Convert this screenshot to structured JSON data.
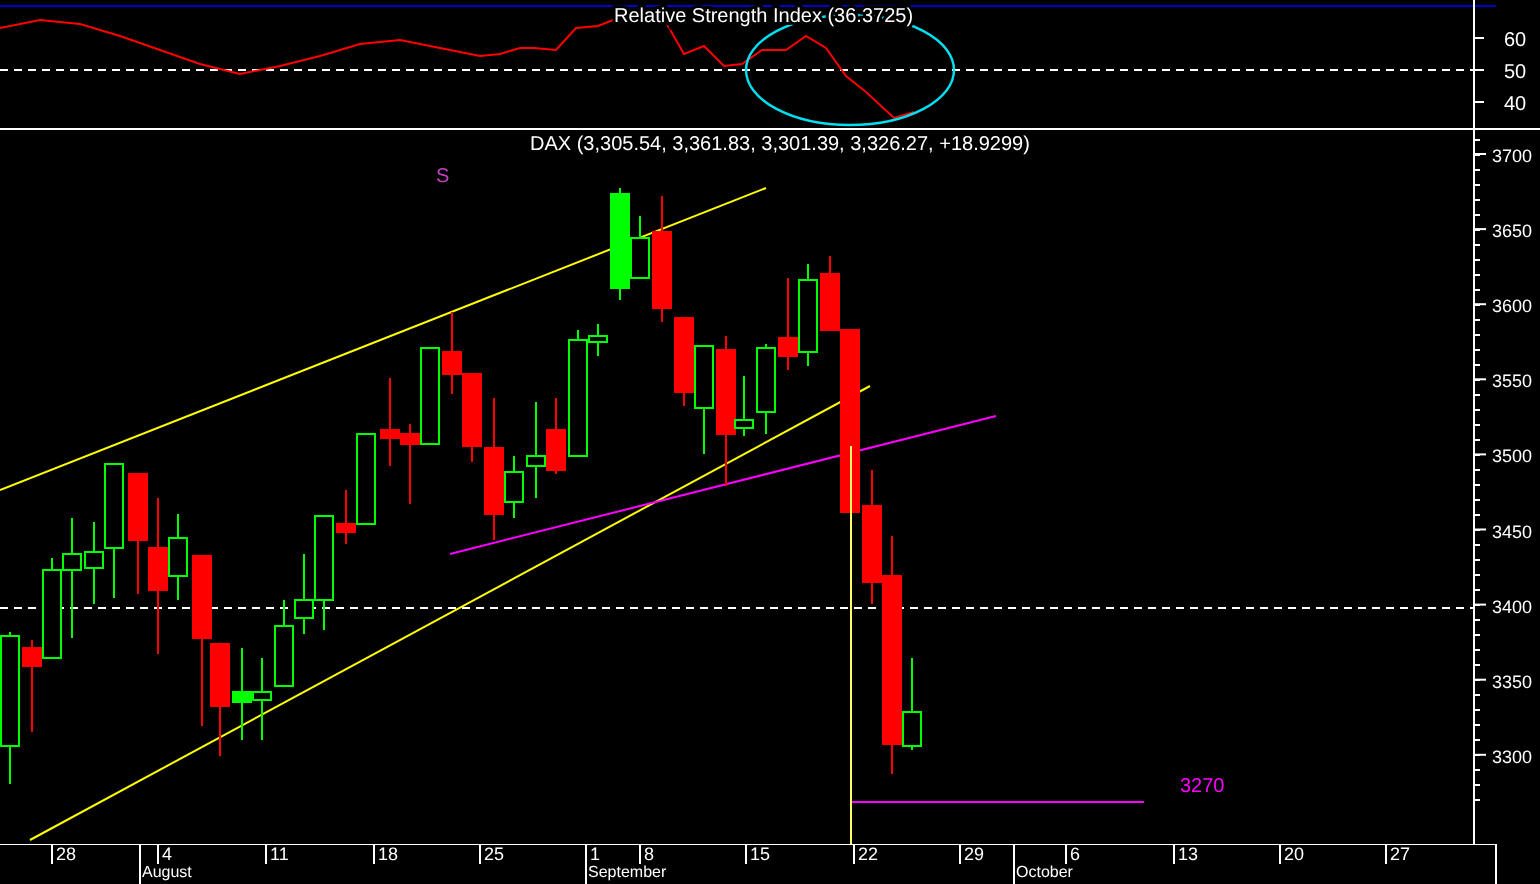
{
  "rsi_panel": {
    "title": "Relative Strength Index (36.3725)",
    "yticks": [
      "60",
      "50",
      "40"
    ]
  },
  "price_panel": {
    "title": "DAX (3,305.54, 3,361.83, 3,301.39, 3,326.27, +18.9299)",
    "marker": "S",
    "target_label": "3270",
    "yticks": [
      "3700",
      "3650",
      "3600",
      "3550",
      "3500",
      "3450",
      "3400",
      "3350",
      "3300"
    ]
  },
  "date_axis": {
    "days": [
      "28",
      "4",
      "11",
      "18",
      "25",
      "1",
      "8",
      "15",
      "22",
      "29",
      "6",
      "13",
      "20",
      "27"
    ],
    "months": [
      "August",
      "September",
      "October"
    ]
  }
}
